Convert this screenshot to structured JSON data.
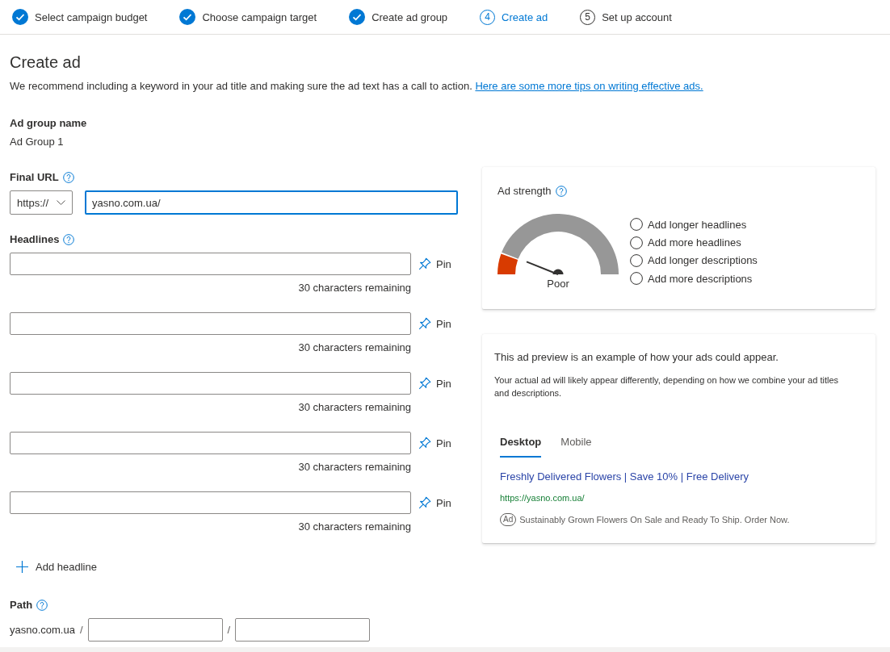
{
  "steps": [
    {
      "label": "Select campaign budget",
      "completed": true,
      "selected": false
    },
    {
      "label": "Choose campaign target",
      "completed": true,
      "selected": false
    },
    {
      "label": "Create ad group",
      "completed": true,
      "selected": false
    },
    {
      "label": "Create ad",
      "number": "4",
      "completed": false,
      "selected": true
    },
    {
      "label": "Set up account",
      "number": "5",
      "completed": false,
      "selected": false
    }
  ],
  "page": {
    "title": "Create ad",
    "intro": "We recommend including a keyword in your ad title and making sure the ad text has a call to action.",
    "tips_link": "Here are some more tips on writing effective ads."
  },
  "ad_group": {
    "label": "Ad group name",
    "value": "Ad Group 1"
  },
  "final_url": {
    "label": "Final URL",
    "protocol": "https://",
    "value": "yasno.com.ua/",
    "focused": true
  },
  "headlines": {
    "label": "Headlines",
    "items": [
      {
        "pin": "Pin",
        "remaining": "30 characters remaining"
      },
      {
        "pin": "Pin",
        "remaining": "30 characters remaining"
      },
      {
        "pin": "Pin",
        "remaining": "30 characters remaining"
      },
      {
        "pin": "Pin",
        "remaining": "30 characters remaining"
      },
      {
        "pin": "Pin",
        "remaining": "30 characters remaining"
      }
    ],
    "add": "Add headline"
  },
  "path": {
    "label": "Path",
    "domain": "yasno.com.ua",
    "fields": [
      {
        "separator": "/"
      },
      {
        "separator": "/"
      }
    ]
  },
  "ad_strength": {
    "title": "Ad strength",
    "level": 0.11,
    "rating": "Poor",
    "suggestions": [
      {
        "label": "Add longer headlines",
        "checked": false
      },
      {
        "label": "Add more headlines",
        "checked": false
      },
      {
        "label": "Add longer descriptions",
        "checked": false
      },
      {
        "label": "Add more descriptions",
        "checked": false
      }
    ]
  },
  "preview": {
    "intro": "This ad preview is an example of how your ads could appear.",
    "note": "Your actual ad will likely appear differently, depending on how we combine your ad titles and descriptions.",
    "tabs": [
      {
        "label": "Desktop",
        "selected": true
      },
      {
        "label": "Mobile",
        "selected": false
      }
    ],
    "ad": {
      "title": "Freshly Delivered Flowers | Save 10% | Free Delivery",
      "url": "https://yasno.com.ua/",
      "badge": "Ad",
      "description": "Sustainably Grown Flowers On Sale and Ready To Ship. Order Now."
    }
  }
}
